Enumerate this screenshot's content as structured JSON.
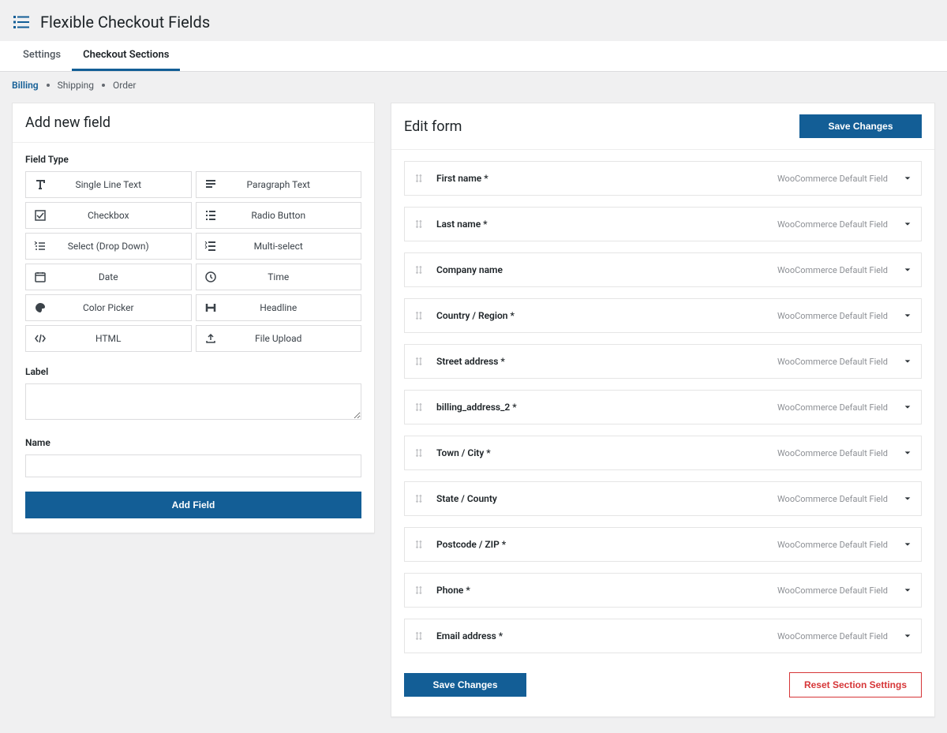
{
  "header": {
    "title": "Flexible Checkout Fields"
  },
  "tabs": [
    {
      "label": "Settings",
      "active": false
    },
    {
      "label": "Checkout Sections",
      "active": true
    }
  ],
  "subnav": [
    {
      "label": "Billing",
      "active": true
    },
    {
      "label": "Shipping",
      "active": false
    },
    {
      "label": "Order",
      "active": false
    }
  ],
  "addField": {
    "title": "Add new field",
    "fieldTypeLabel": "Field Type",
    "labelLabel": "Label",
    "nameLabel": "Name",
    "buttonLabel": "Add Field",
    "types": [
      {
        "label": "Single Line Text",
        "icon": "text-icon"
      },
      {
        "label": "Paragraph Text",
        "icon": "paragraph-icon"
      },
      {
        "label": "Checkbox",
        "icon": "checkbox-icon"
      },
      {
        "label": "Radio Button",
        "icon": "radio-icon"
      },
      {
        "label": "Select (Drop Down)",
        "icon": "select-icon"
      },
      {
        "label": "Multi-select",
        "icon": "multiselect-icon"
      },
      {
        "label": "Date",
        "icon": "date-icon"
      },
      {
        "label": "Time",
        "icon": "time-icon"
      },
      {
        "label": "Color Picker",
        "icon": "color-icon"
      },
      {
        "label": "Headline",
        "icon": "headline-icon"
      },
      {
        "label": "HTML",
        "icon": "html-icon"
      },
      {
        "label": "File Upload",
        "icon": "upload-icon"
      }
    ]
  },
  "editForm": {
    "title": "Edit form",
    "saveLabel": "Save Changes",
    "resetLabel": "Reset Section Settings",
    "defaultBadge": "WooCommerce Default Field",
    "fields": [
      {
        "label": "First name *"
      },
      {
        "label": "Last name *"
      },
      {
        "label": "Company name"
      },
      {
        "label": "Country / Region *"
      },
      {
        "label": "Street address *"
      },
      {
        "label": "billing_address_2 *"
      },
      {
        "label": "Town / City *"
      },
      {
        "label": "State / County"
      },
      {
        "label": "Postcode / ZIP *"
      },
      {
        "label": "Phone *"
      },
      {
        "label": "Email address *"
      }
    ]
  }
}
